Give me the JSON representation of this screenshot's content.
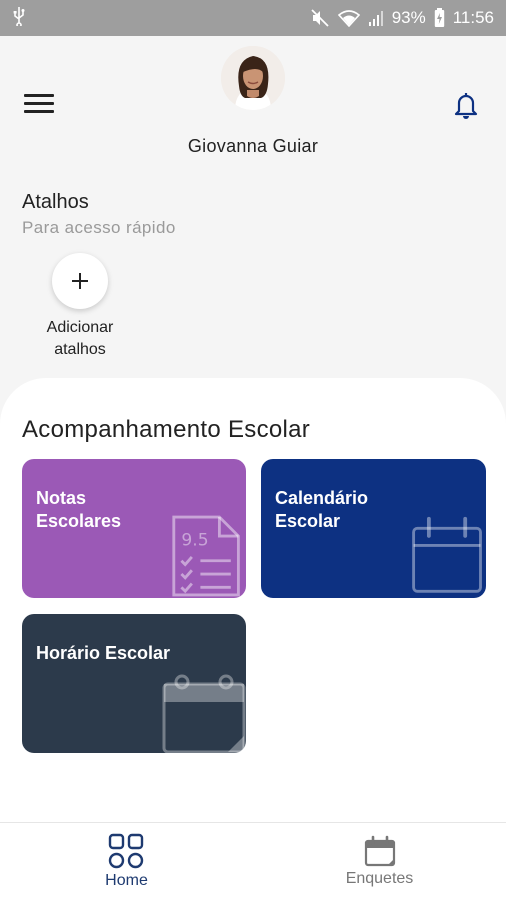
{
  "status_bar": {
    "battery": "93%",
    "time": "11:56"
  },
  "header": {
    "user_name": "Giovanna Guiar"
  },
  "shortcuts": {
    "title": "Atalhos",
    "subtitle": "Para acesso rápido",
    "add_label": "Adicionar atalhos"
  },
  "school": {
    "title": "Acompanhamento Escolar",
    "cards": [
      {
        "label": "Notas Escolares",
        "color": "#9b59b6",
        "icon": "grades-icon"
      },
      {
        "label": "Calendário Escolar",
        "color": "#0d3182",
        "icon": "calendar-icon"
      },
      {
        "label": "Horário Escolar",
        "color": "#2c3a4b",
        "icon": "schedule-icon"
      }
    ]
  },
  "bottom_nav": {
    "items": [
      {
        "label": "Home",
        "icon": "home-grid-icon",
        "active": true
      },
      {
        "label": "Enquetes",
        "icon": "polls-calendar-icon",
        "active": false
      }
    ]
  },
  "colors": {
    "accent": "#0d3182",
    "home_active": "#1e3a70",
    "inactive": "#777777"
  }
}
